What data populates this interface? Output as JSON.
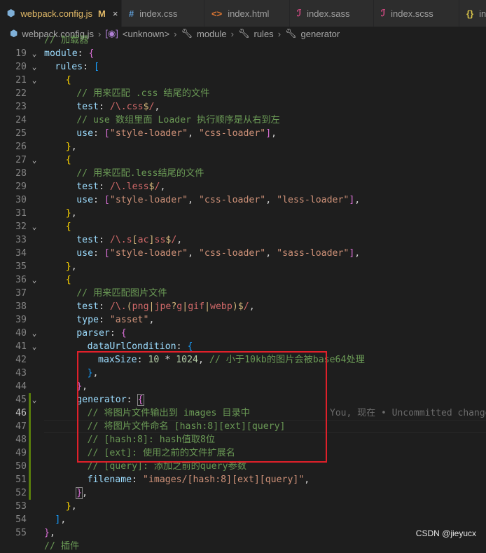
{
  "tabs": [
    {
      "label": "webpack.config.js",
      "status": "M",
      "icon": "js-gear-icon",
      "active": true
    },
    {
      "label": "index.css",
      "icon": "css-hash-icon"
    },
    {
      "label": "index.html",
      "icon": "html-brackets-icon"
    },
    {
      "label": "index.sass",
      "icon": "sass-icon"
    },
    {
      "label": "index.scss",
      "icon": "scss-icon"
    },
    {
      "label": "in",
      "icon": "json-braces-icon"
    }
  ],
  "tab_close": "×",
  "breadcrumb": [
    "webpack.config.js",
    "<unknown>",
    "module",
    "rules",
    "generator"
  ],
  "blame": "You, 现在 • Uncommitted changes",
  "watermark": "CSDN @jieyucx",
  "lines": [
    {
      "n": "",
      "t": "// 加载器"
    },
    {
      "n": "19",
      "t": "module: {"
    },
    {
      "n": "20",
      "t": "rules: ["
    },
    {
      "n": "21",
      "t": "{"
    },
    {
      "n": "22",
      "t": "// 用来匹配 .css 结尾的文件"
    },
    {
      "n": "23",
      "t": "test: /\\.css$/,"
    },
    {
      "n": "24",
      "t": "// use 数组里面 Loader 执行顺序是从右到左"
    },
    {
      "n": "25",
      "t": "use: [\"style-loader\", \"css-loader\"],"
    },
    {
      "n": "26",
      "t": "},"
    },
    {
      "n": "27",
      "t": "{"
    },
    {
      "n": "28",
      "t": "// 用来匹配.less结尾的文件"
    },
    {
      "n": "29",
      "t": "test: /\\.less$/,"
    },
    {
      "n": "30",
      "t": "use: [\"style-loader\", \"css-loader\", \"less-loader\"],"
    },
    {
      "n": "31",
      "t": "},"
    },
    {
      "n": "32",
      "t": "{"
    },
    {
      "n": "33",
      "t": "test: /\\.s[ac]ss$/,"
    },
    {
      "n": "34",
      "t": "use: [\"style-loader\", \"css-loader\", \"sass-loader\"],"
    },
    {
      "n": "35",
      "t": "},"
    },
    {
      "n": "36",
      "t": "{"
    },
    {
      "n": "37",
      "t": "// 用来匹配图片文件"
    },
    {
      "n": "38",
      "t": "test: /\\.(png|jpe?g|gif|webp)$/,"
    },
    {
      "n": "39",
      "t": "type: \"asset\","
    },
    {
      "n": "40",
      "t": "parser: {"
    },
    {
      "n": "41",
      "t": "dataUrlCondition: {"
    },
    {
      "n": "42",
      "t": "maxSize: 10 * 1024, // 小于10kb的图片会被base64处理"
    },
    {
      "n": "43",
      "t": "},"
    },
    {
      "n": "44",
      "t": "},"
    },
    {
      "n": "45",
      "t": "generator: {"
    },
    {
      "n": "46",
      "t": "// 将图片文件输出到 images 目录中"
    },
    {
      "n": "47",
      "t": "// 将图片文件命名 [hash:8][ext][query]"
    },
    {
      "n": "48",
      "t": "// [hash:8]: hash值取8位"
    },
    {
      "n": "49",
      "t": "// [ext]: 使用之前的文件扩展名"
    },
    {
      "n": "50",
      "t": "// [query]: 添加之前的query参数"
    },
    {
      "n": "51",
      "t": "filename: \"images/[hash:8][ext][query]\","
    },
    {
      "n": "52",
      "t": "},"
    },
    {
      "n": "53",
      "t": "},"
    },
    {
      "n": "54",
      "t": "],"
    },
    {
      "n": "55",
      "t": "},"
    },
    {
      "n": "",
      "t": "// 插件"
    }
  ]
}
